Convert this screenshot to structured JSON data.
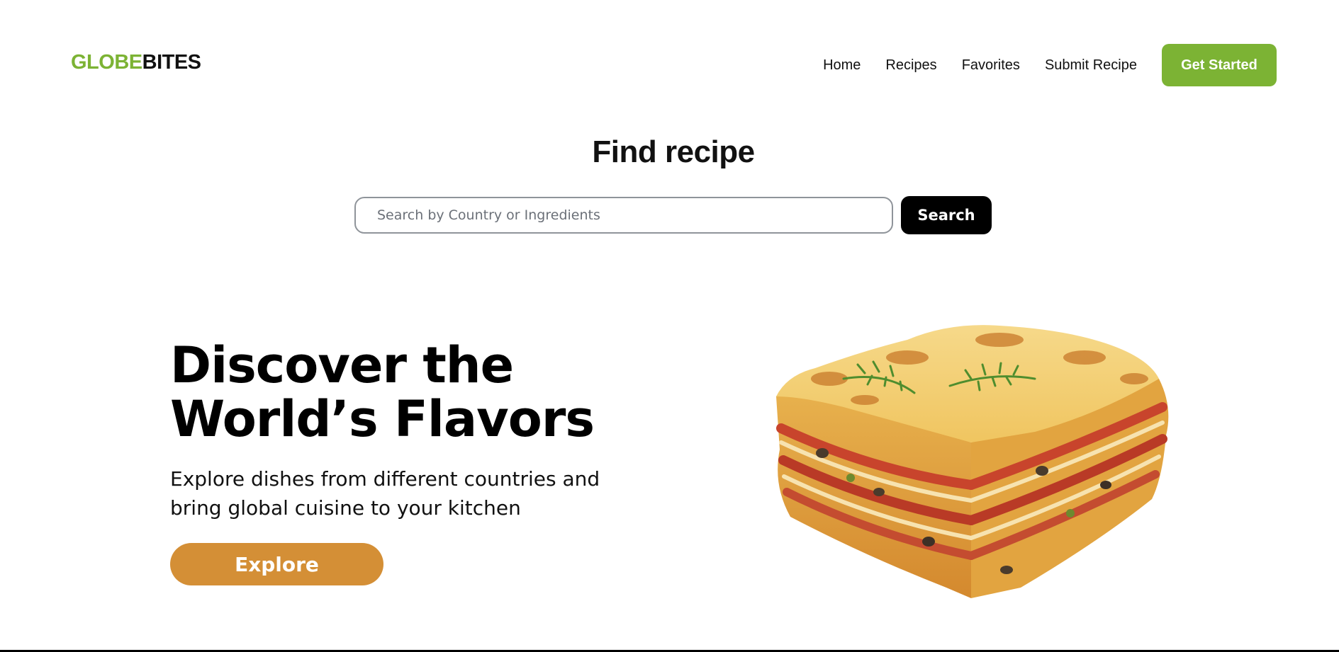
{
  "brand": {
    "logo_part_1": "GLOBE",
    "logo_part_2": "BITES",
    "accent_color": "#7cb334"
  },
  "nav": {
    "items": [
      {
        "label": "Home"
      },
      {
        "label": "Recipes"
      },
      {
        "label": "Favorites"
      },
      {
        "label": "Submit Recipe"
      }
    ],
    "cta_label": "Get Started"
  },
  "search": {
    "title": "Find recipe",
    "placeholder": "Search by Country or Ingredients",
    "value": "",
    "button_label": "Search"
  },
  "hero": {
    "title": "Discover the World’s Flavors",
    "subtitle": "Explore dishes from different countries and bring global cuisine to your kitchen",
    "button_label": "Explore",
    "button_color": "#d48f36",
    "image_icon": "lasagna-image"
  }
}
